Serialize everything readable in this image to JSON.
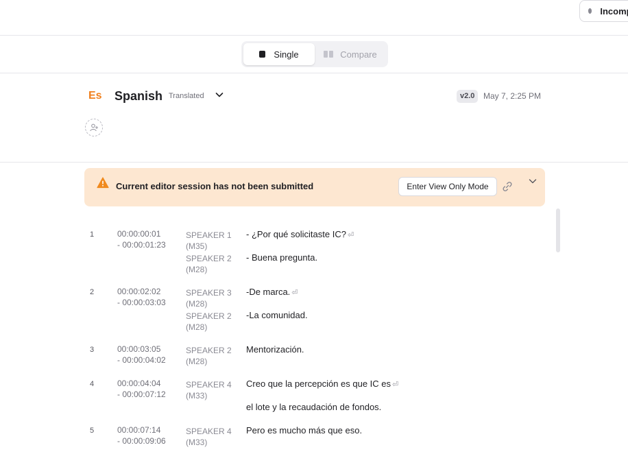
{
  "topbar": {
    "status_label": "Incomplete"
  },
  "mode_toggle": {
    "single_label": "Single",
    "compare_label": "Compare",
    "active": "single"
  },
  "header": {
    "lang_code": "Es",
    "lang_name": "Spanish",
    "status": "Translated",
    "version": "v2.0",
    "timestamp": "May 7, 2:25 PM"
  },
  "banner": {
    "message": "Current editor session has not been submitted",
    "view_only_button": "Enter View Only Mode"
  },
  "colors": {
    "accent": "#f07f1c",
    "banner_bg": "#fde7d1",
    "warning": "#f08a1e"
  },
  "segments": [
    {
      "index": "1",
      "start": "00:00:00:01",
      "end": "- 00:00:01:23",
      "lines": [
        {
          "speaker": "SPEAKER 1",
          "speaker_id": "(M35)",
          "text": "- ¿Por qué solicitaste IC?",
          "return": true
        },
        {
          "speaker": "SPEAKER 2",
          "speaker_id": "(M28)",
          "text": "- Buena pregunta.",
          "return": false
        }
      ]
    },
    {
      "index": "2",
      "start": "00:00:02:02",
      "end": "- 00:00:03:03",
      "lines": [
        {
          "speaker": "SPEAKER 3",
          "speaker_id": "(M28)",
          "text": "-De marca.",
          "return": true
        },
        {
          "speaker": "SPEAKER 2",
          "speaker_id": "(M28)",
          "text": "-La comunidad.",
          "return": false
        }
      ]
    },
    {
      "index": "3",
      "start": "00:00:03:05",
      "end": "- 00:00:04:02",
      "lines": [
        {
          "speaker": "SPEAKER 2",
          "speaker_id": "(M28)",
          "text": "Mentorización.",
          "return": false
        }
      ]
    },
    {
      "index": "4",
      "start": "00:00:04:04",
      "end": "- 00:00:07:12",
      "lines": [
        {
          "speaker": "SPEAKER 4",
          "speaker_id": "(M33)",
          "text": "Creo que la percepción es que IC es",
          "return": true
        },
        {
          "speaker": "",
          "speaker_id": "",
          "text": "el lote y la recaudación de fondos.",
          "return": false
        }
      ]
    },
    {
      "index": "5",
      "start": "00:00:07:14",
      "end": "- 00:00:09:06",
      "lines": [
        {
          "speaker": "SPEAKER 4",
          "speaker_id": "(M33)",
          "text": "Pero es mucho más que eso.",
          "return": false
        }
      ]
    }
  ]
}
